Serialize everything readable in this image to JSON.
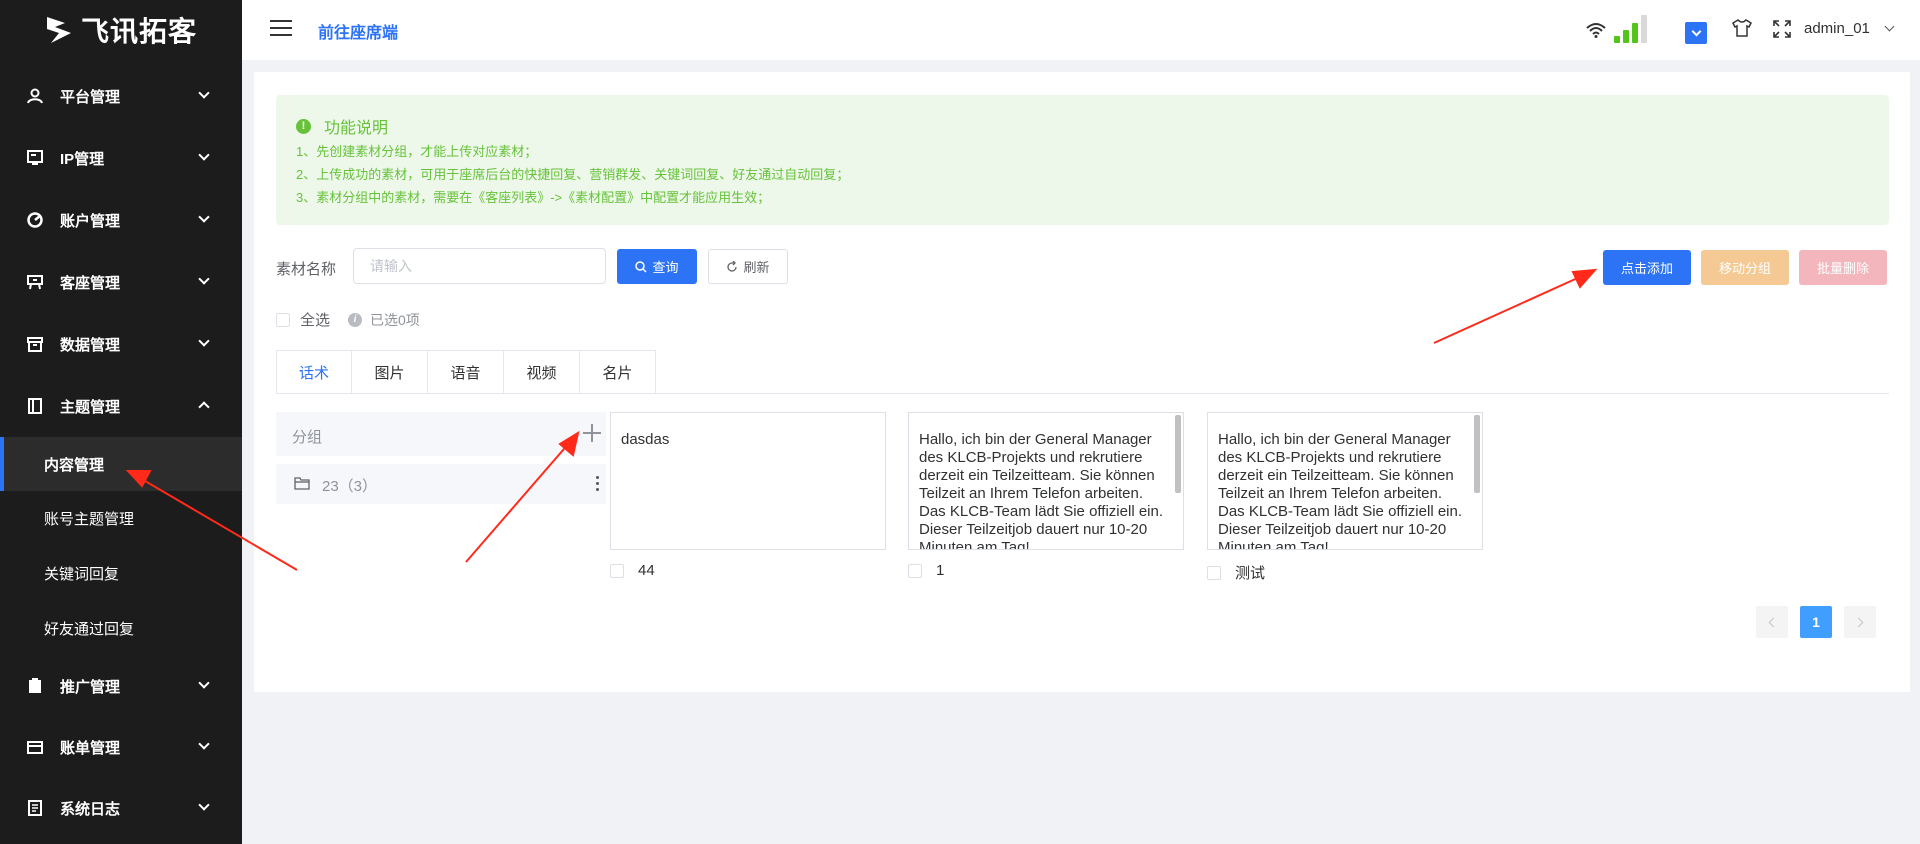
{
  "sidebar": {
    "logo_text": "飞讯拓客",
    "items": [
      {
        "label": "平台管理"
      },
      {
        "label": "IP管理"
      },
      {
        "label": "账户管理"
      },
      {
        "label": "客座管理"
      },
      {
        "label": "数据管理"
      },
      {
        "label": "主题管理"
      },
      {
        "label": "推广管理"
      },
      {
        "label": "账单管理"
      },
      {
        "label": "系统日志"
      }
    ],
    "sub_items": [
      {
        "label": "内容管理"
      },
      {
        "label": "账号主题管理"
      },
      {
        "label": "关键词回复"
      },
      {
        "label": "好友通过回复"
      }
    ]
  },
  "header": {
    "goto_label": "前往座席端",
    "username": "admin_01"
  },
  "notice": {
    "title": "功能说明",
    "lines": [
      "1、先创建素材分组，才能上传对应素材；",
      "2、上传成功的素材，可用于座席后台的快捷回复、营销群发、关键词回复、好友通过自动回复；",
      "3、素材分组中的素材，需要在《客座列表》->《素材配置》中配置才能应用生效；"
    ]
  },
  "filter": {
    "label": "素材名称",
    "placeholder": "请输入",
    "query_label": "查询",
    "refresh_label": "刷新"
  },
  "actions": {
    "add_label": "点击添加",
    "move_label": "移动分组",
    "delete_label": "批量删除"
  },
  "selection": {
    "select_all_label": "全选",
    "selected_text": "已选0项"
  },
  "tabs": [
    {
      "label": "话术"
    },
    {
      "label": "图片"
    },
    {
      "label": "语音"
    },
    {
      "label": "视频"
    },
    {
      "label": "名片"
    }
  ],
  "groups": {
    "header_label": "分组",
    "items": [
      {
        "label": "23（3）"
      }
    ]
  },
  "materials": [
    {
      "text": "dasdas",
      "name": "44"
    },
    {
      "text": "Hallo, ich bin der General Manager des KLCB-Projekts und rekrutiere derzeit ein Teilzeitteam. Sie können Teilzeit an Ihrem Telefon arbeiten. Das KLCB-Team lädt Sie offiziell ein. Dieser Teilzeitjob dauert nur 10-20 Minuten am Tag!",
      "name": "1"
    },
    {
      "text": "Hallo, ich bin der General Manager des KLCB-Projekts und rekrutiere derzeit ein Teilzeitteam. Sie können Teilzeit an Ihrem Telefon arbeiten. Das KLCB-Team lädt Sie offiziell ein. Dieser Teilzeitjob dauert nur 10-20 Minuten am Tag!",
      "name": "测试"
    }
  ],
  "pagination": {
    "current_page": "1",
    "prev_icon": "chevron-left-icon",
    "next_icon": "chevron-right-icon"
  },
  "colors": {
    "primary": "#2d73f5",
    "success": "#67c23a",
    "warning": "#f5c993",
    "danger": "#f4b6bd",
    "annotation": "#ff2a1a"
  }
}
